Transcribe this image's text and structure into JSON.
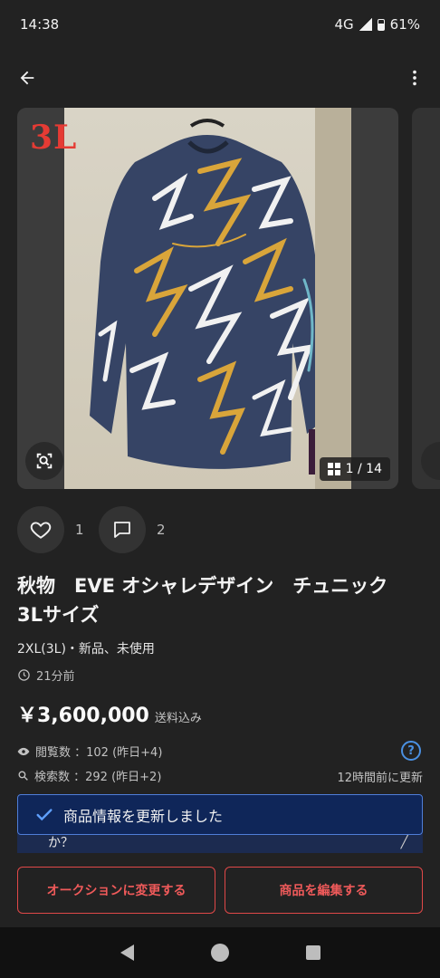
{
  "status_bar": {
    "time": "14:38",
    "network": "4G",
    "battery": "61%"
  },
  "carousel": {
    "corner_label": "3L",
    "counter": "1 / 14"
  },
  "actions": {
    "like_count": "1",
    "comment_count": "2"
  },
  "product": {
    "title": "秋物　EVE オシャレデザイン　チュニック　3Lサイズ",
    "size_condition": "2XL(3L)・新品、未使用",
    "posted": "21分前",
    "price": "￥3,600,000",
    "shipping_note": "送料込み"
  },
  "stats": {
    "views": "閲覧数 ：102 (昨日+4)",
    "searches": "検索数 ：292 (昨日+2)",
    "updated": "12時間前に更新"
  },
  "toast": {
    "message": "商品情報を更新しました"
  },
  "banner": {
    "text": "か？"
  },
  "buttons": {
    "auction": "オークションに変更する",
    "edit": "商品を編集する"
  },
  "colors": {
    "accent_red": "#e04848",
    "toast_bg": "#0f2659",
    "help_blue": "#4a90e2",
    "background": "#222222"
  },
  "icons": [
    "back-arrow-icon",
    "more-vert-icon",
    "lens-search-icon",
    "gallery-grid-icon",
    "heart-icon",
    "comment-icon",
    "clock-icon",
    "eye-icon",
    "search-icon",
    "help-icon",
    "check-icon"
  ]
}
